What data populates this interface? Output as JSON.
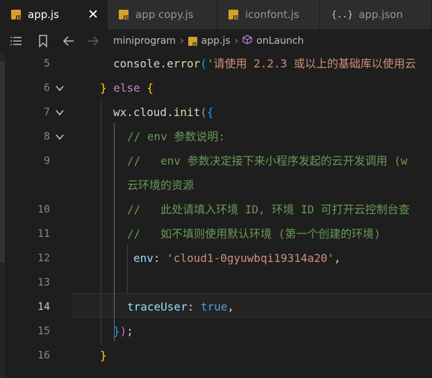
{
  "tabs": [
    {
      "label": "app.js",
      "icon": "js-file-icon",
      "active": true,
      "close": "✕"
    },
    {
      "label": "app copy.js",
      "icon": "js-file-icon"
    },
    {
      "label": "iconfont.js",
      "icon": "js-file-icon"
    },
    {
      "label": "app.json",
      "icon": "json-file-icon",
      "icon_text": "{..}"
    }
  ],
  "toolbar": {
    "icons": [
      "list-icon",
      "bookmark-icon",
      "back-arrow-icon",
      "forward-arrow-icon"
    ],
    "breadcrumb": [
      "miniprogram",
      "app.js",
      "onLaunch"
    ],
    "separator": "›"
  },
  "editor": {
    "lines": [
      {
        "num": "5",
        "tokens": [
          {
            "t": "console.",
            "c": "def"
          },
          {
            "t": "error",
            "c": "fn"
          },
          {
            "t": "(",
            "c": "b3"
          },
          {
            "t": "'请使用 2.2.3 或以上的基础库以使用云",
            "c": "str"
          }
        ]
      },
      {
        "num": "6",
        "fold": true,
        "tokens": [
          {
            "t": "} ",
            "c": "b1"
          },
          {
            "t": "else",
            "c": "kw"
          },
          {
            "t": " {",
            "c": "b1"
          }
        ]
      },
      {
        "num": "7",
        "fold": true,
        "tokens": [
          {
            "t": "wx.cloud.",
            "c": "def"
          },
          {
            "t": "init",
            "c": "fn"
          },
          {
            "t": "(",
            "c": "b2"
          },
          {
            "t": "{",
            "c": "b3"
          }
        ]
      },
      {
        "num": "8",
        "fold": true,
        "tokens": [
          {
            "t": "// env 参数说明:",
            "c": "com"
          }
        ]
      },
      {
        "num": "9",
        "tokens": [
          {
            "t": "//   env 参数决定接下来小程序发起的云开发调用 (w",
            "c": "com"
          }
        ]
      },
      {
        "num": "",
        "tokens": [
          {
            "t": "云环境的资源",
            "c": "com"
          }
        ]
      },
      {
        "num": "10",
        "tokens": [
          {
            "t": "//   此处请填入环境 ID, 环境 ID 可打开云控制台查",
            "c": "com"
          }
        ]
      },
      {
        "num": "11",
        "tokens": [
          {
            "t": "//   如不填则使用默认环境 (第一个创建的环境)",
            "c": "com"
          }
        ]
      },
      {
        "num": "12",
        "tokens": [
          {
            "t": "env",
            "c": "prop"
          },
          {
            "t": ": ",
            "c": "def"
          },
          {
            "t": "'cloud1-0gyuwbqi19314a20'",
            "c": "str"
          },
          {
            "t": ",",
            "c": "def"
          }
        ]
      },
      {
        "num": "13",
        "tokens": []
      },
      {
        "num": "14",
        "active": true,
        "tokens": [
          {
            "t": "traceUser",
            "c": "prop"
          },
          {
            "t": ": ",
            "c": "def"
          },
          {
            "t": "true",
            "c": "kw2"
          },
          {
            "t": ",",
            "c": "def"
          }
        ]
      },
      {
        "num": "15",
        "tokens": [
          {
            "t": "}",
            "c": "b3"
          },
          {
            "t": ")",
            "c": "b2"
          },
          {
            "t": ";",
            "c": "def"
          }
        ]
      },
      {
        "num": "16",
        "tokens": [
          {
            "t": "}",
            "c": "b1"
          }
        ]
      }
    ]
  }
}
